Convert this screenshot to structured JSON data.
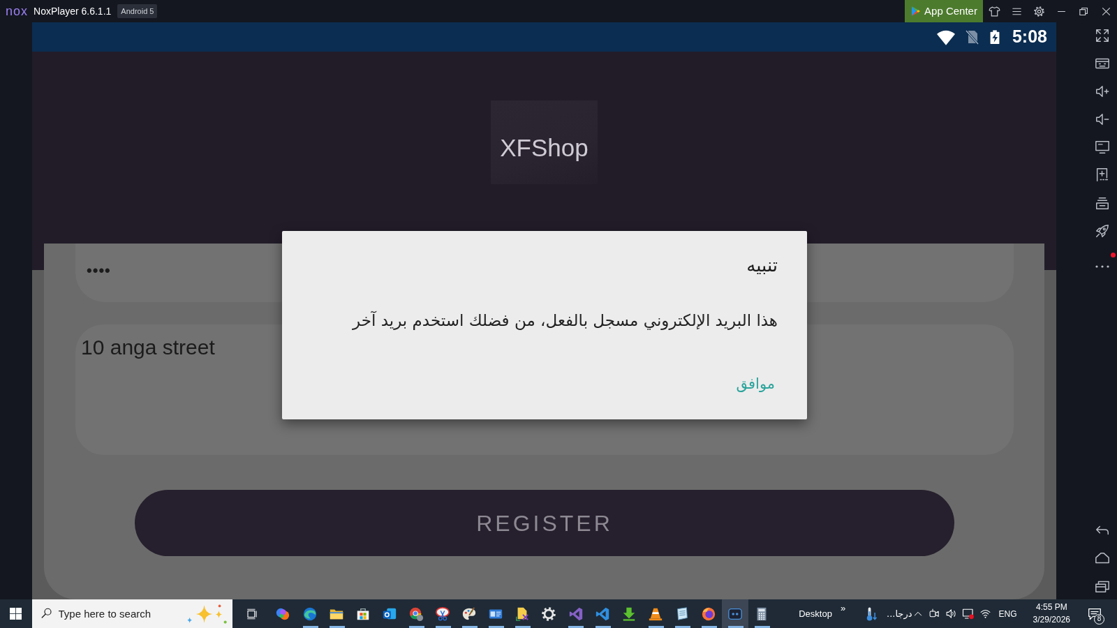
{
  "title_bar": {
    "logo_text": "nox",
    "title": "NoxPlayer 6.6.1.1",
    "version_badge": "Android 5",
    "app_center_label": "App Center"
  },
  "status_bar": {
    "time": "5:08"
  },
  "app": {
    "logo_text": "XFShop",
    "password_field": {
      "value": "••••"
    },
    "address_field": {
      "value": "10 anga street"
    },
    "register_button": "REGISTER"
  },
  "dialog": {
    "title": "تنبيه",
    "message": "هذا البريد الإلكتروني مسجل بالفعل، من فضلك استخدم بريد آخر",
    "ok_button": "موافق"
  },
  "sidebar": {
    "more_alert": true
  },
  "taskbar": {
    "search_placeholder": "Type here to search",
    "apps": [
      {
        "running": false,
        "selected": false
      },
      {
        "running": true,
        "selected": false
      },
      {
        "running": true,
        "selected": false
      },
      {
        "running": false,
        "selected": false
      },
      {
        "running": false,
        "selected": false
      },
      {
        "running": true,
        "selected": false
      },
      {
        "running": true,
        "selected": false
      },
      {
        "running": true,
        "selected": false
      },
      {
        "running": true,
        "selected": false
      },
      {
        "running": true,
        "selected": false
      },
      {
        "running": false,
        "selected": false
      },
      {
        "running": true,
        "selected": false
      },
      {
        "running": true,
        "selected": false
      },
      {
        "running": false,
        "selected": false
      },
      {
        "running": true,
        "selected": false
      },
      {
        "running": true,
        "selected": false
      },
      {
        "running": true,
        "selected": false
      },
      {
        "running": true,
        "selected": true
      },
      {
        "running": true,
        "selected": false
      }
    ],
    "desktop_label": "Desktop",
    "desktop_chevron": "»",
    "weather_text": "درجا...",
    "language": "ENG",
    "time": "4:55 PM",
    "date": "3/29/2026",
    "notification_count": "8"
  }
}
